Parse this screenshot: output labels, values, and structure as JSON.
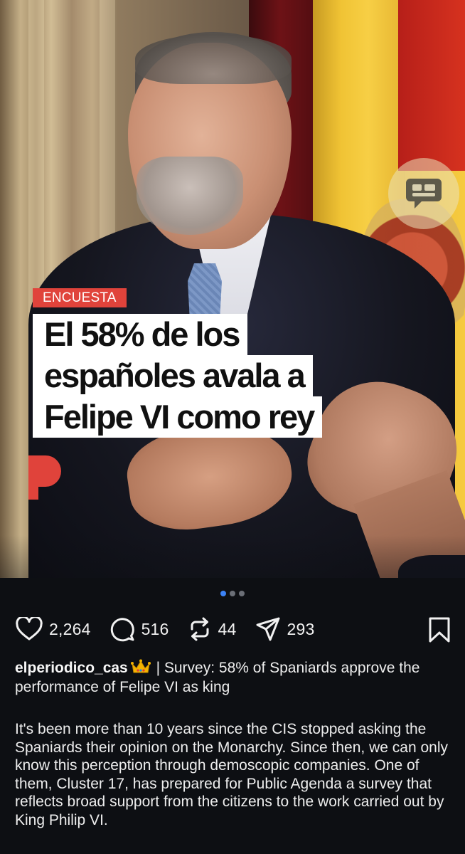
{
  "photo": {
    "tag": "ENCUESTA",
    "headline_lines": [
      "El 58% de los",
      "españoles avala a",
      "Felipe VI como rey"
    ],
    "comment_icon": "speech-bubble-icon",
    "logo_icon": "el-periodico-p-logo"
  },
  "carousel": {
    "total": 3,
    "active": 1
  },
  "actions": {
    "likes": "2,264",
    "comments": "516",
    "reposts": "44",
    "shares": "293",
    "like_icon": "heart-icon",
    "comment_icon": "comment-icon",
    "repost_icon": "repost-icon",
    "share_icon": "send-icon",
    "bookmark_icon": "bookmark-icon"
  },
  "caption": {
    "username": "elperiodico_cas",
    "emoji": "crown-emoji",
    "text": " | Survey: 58% of Spaniards approve the performance of Felipe VI as king"
  },
  "body": "It's been more than 10 years since the CIS stopped asking the Spaniards their opinion on the Monarchy. Since then, we can only know this perception through demoscopic companies. One of them, Cluster 17, has prepared for Public Agenda a survey that reflects broad support from the citizens to the work carried out by King Philip VI."
}
